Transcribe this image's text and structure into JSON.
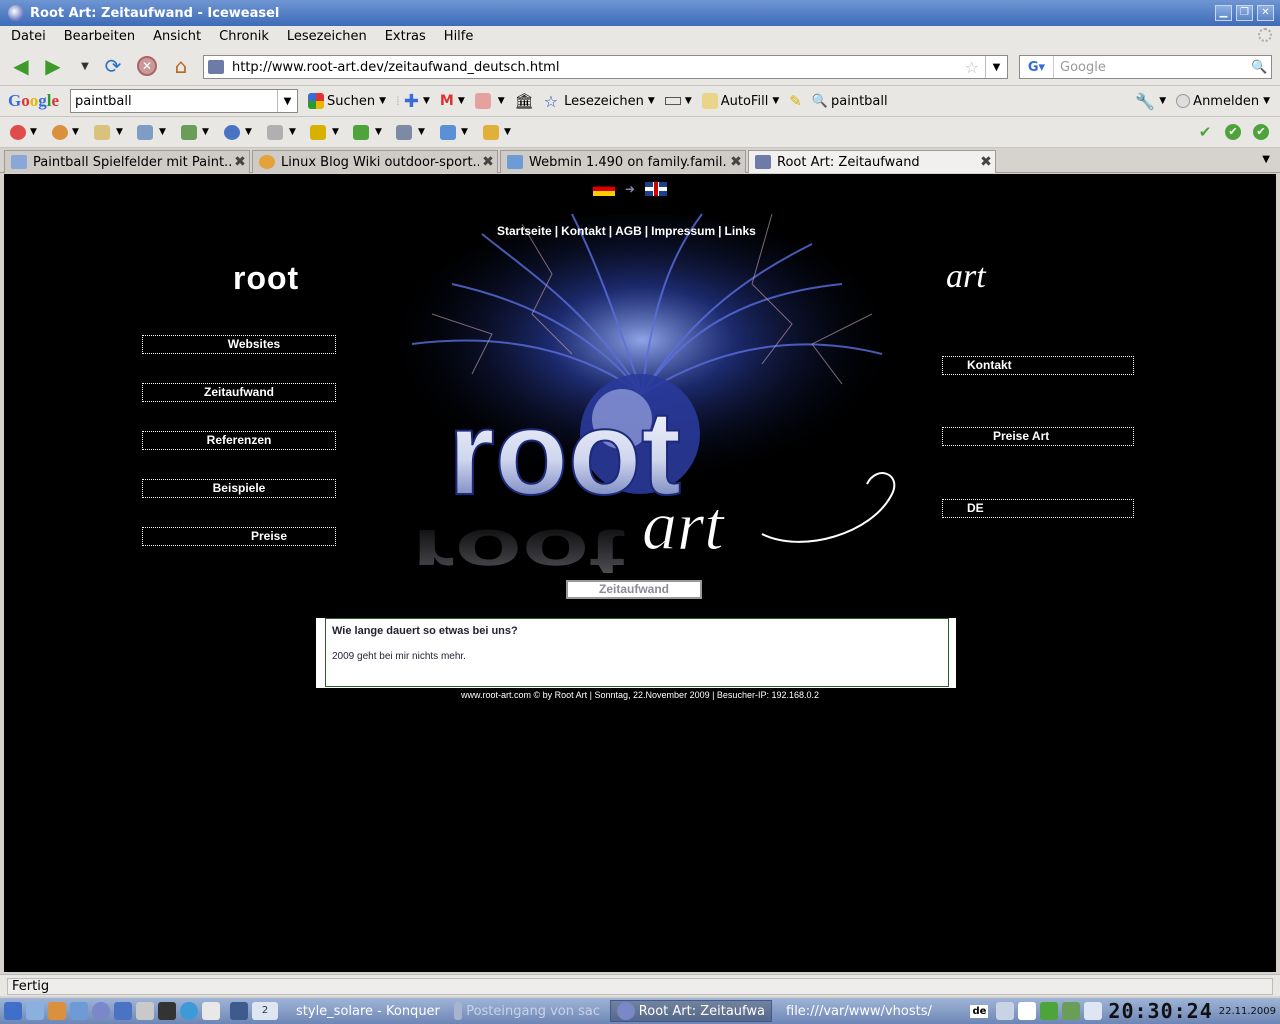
{
  "window": {
    "title": "Root Art: Zeitaufwand - Iceweasel"
  },
  "menu": [
    "Datei",
    "Bearbeiten",
    "Ansicht",
    "Chronik",
    "Lesezeichen",
    "Extras",
    "Hilfe"
  ],
  "nav": {
    "url": "http://www.root-art.dev/zeitaufwand_deutsch.html",
    "search_placeholder": "Google"
  },
  "gtoolbar": {
    "search_value": "paintball",
    "suchen": "Suchen",
    "lesezeichen": "Lesezeichen",
    "autofill": "AutoFill",
    "highlight": "paintball",
    "anmelden": "Anmelden"
  },
  "tabs": [
    {
      "label": "Paintball Spielfelder mit Paint..."
    },
    {
      "label": "Linux Blog Wiki outdoor-sport..."
    },
    {
      "label": "Webmin 1.490 on family.famil..."
    },
    {
      "label": "Root Art: Zeitaufwand"
    }
  ],
  "page": {
    "topnav": [
      "Startseite",
      "Kontakt",
      "AGB",
      "Impressum",
      "Links"
    ],
    "logo_left": "root",
    "logo_right": "art",
    "leftnav": [
      "Websites",
      "Zeitaufwand",
      "Referenzen",
      "Beispiele",
      "Preise"
    ],
    "rightnav": [
      "Kontakt",
      "Preise Art",
      "DE"
    ],
    "section_title": "Zeitaufwand",
    "question": "Wie lange dauert so etwas bei uns?",
    "answer": "2009 geht bei mir nichts mehr.",
    "footer": "www.root-art.com © by Root Art | Sonntag, 22.November 2009 | Besucher-IP: 192.168.0.2"
  },
  "status": "Fertig",
  "taskbar": {
    "tasks": [
      "style_solare - Konquer",
      "Posteingang von sac",
      "Root Art: Zeitaufwa",
      "file:///var/www/vhosts/"
    ],
    "lang": "de",
    "clock": "20:30:24",
    "date": "22.11.2009",
    "desktop": "2"
  }
}
